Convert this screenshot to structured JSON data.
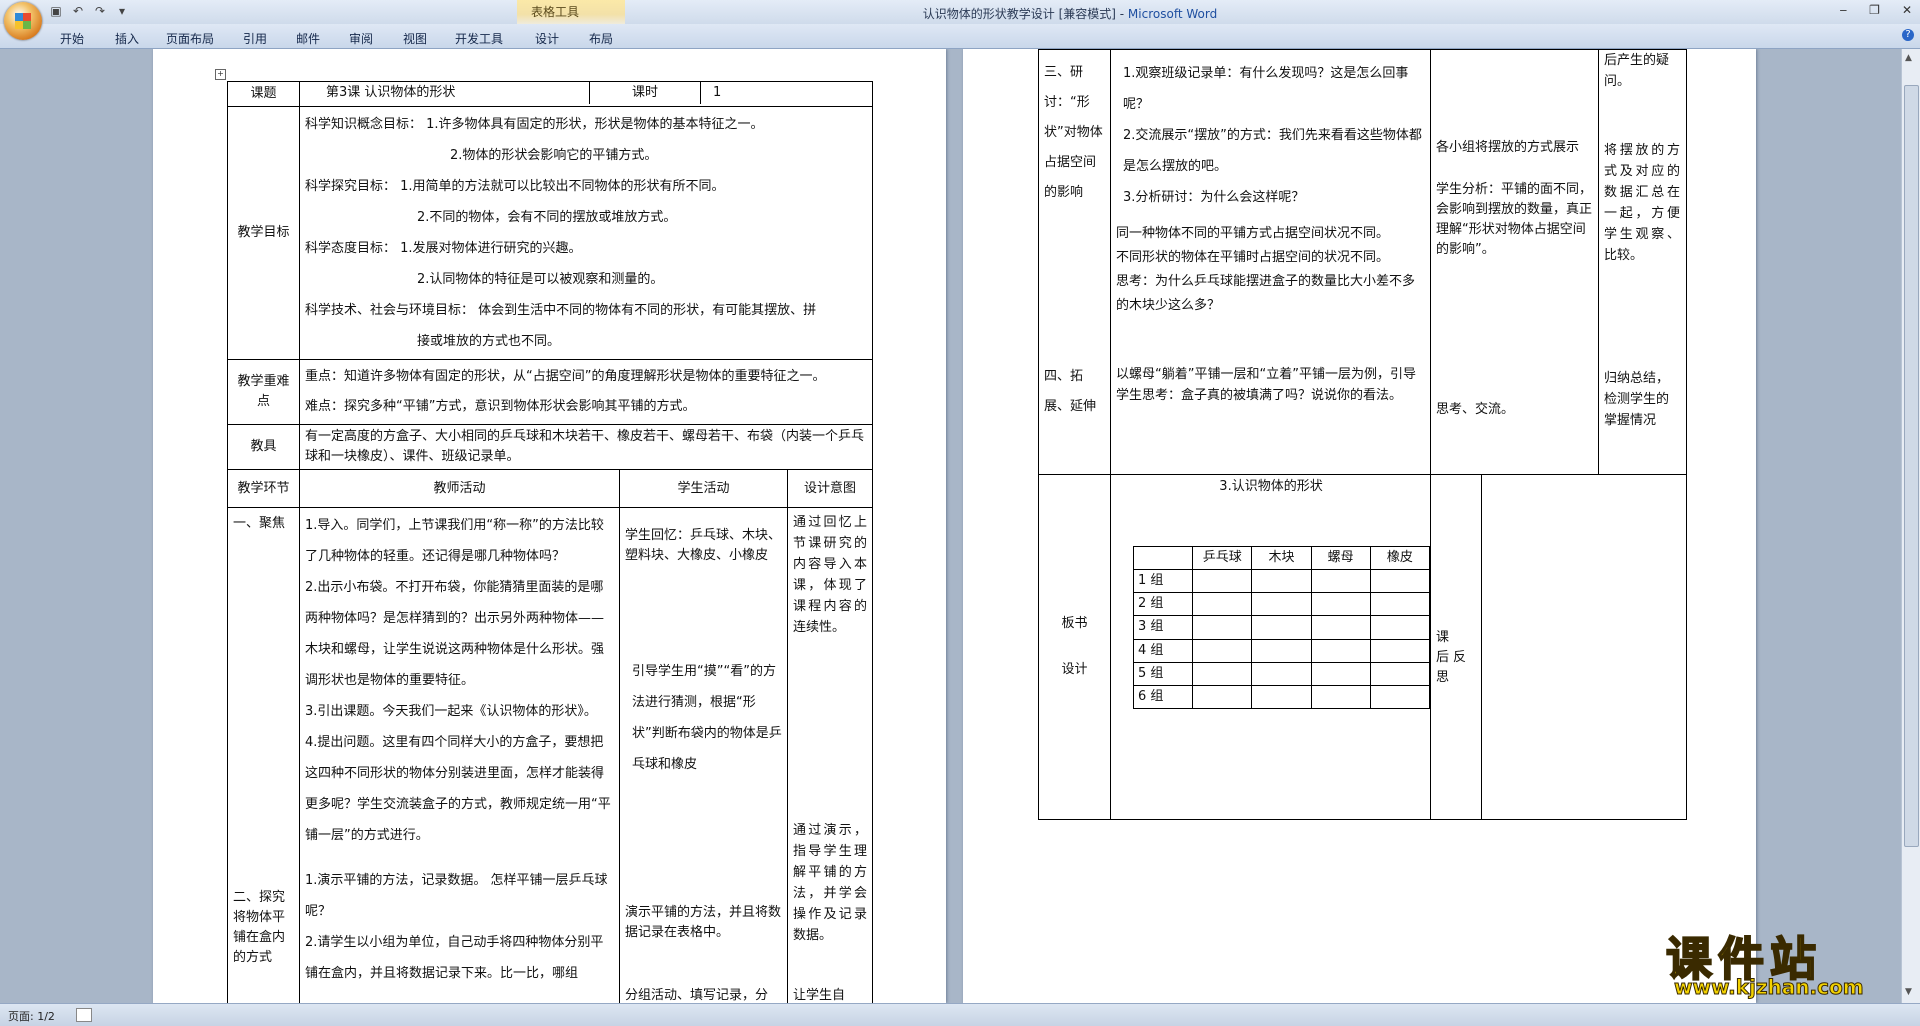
{
  "window": {
    "title": "认识物体的形状教学设计 [兼容模式] - ",
    "app_name": "Microsoft Word",
    "context_tab_group": "表格工具",
    "controls": [
      "‒",
      "❐",
      "✕"
    ]
  },
  "ribbon": {
    "tabs": [
      "开始",
      "插入",
      "页面布局",
      "引用",
      "邮件",
      "审阅",
      "视图",
      "开发工具",
      "设计",
      "布局"
    ]
  },
  "status": {
    "page": "页面: 1/2"
  },
  "watermark": {
    "text": "课件站",
    "url": "www.kjzhan.com"
  },
  "page1": {
    "header": {
      "label": "课题",
      "title": "第3课  认识物体的形状",
      "hours_label": "课时",
      "hours": "1"
    },
    "goals": {
      "label": "教学目标",
      "lines": [
        "科学知识概念目标：  1.许多物体具有固定的形状，形状是物体的基本特征之一。",
        "2.物体的形状会影响它的平铺方式。",
        "科学探究目标：  1.用简单的方法就可以比较出不同物体的形状有所不同。",
        "2.不同的物体，会有不同的摆放或堆放方式。",
        "科学态度目标：  1.发展对物体进行研究的兴趣。",
        "2.认同物体的特征是可以被观察和测量的。",
        "科学技术、社会与环境目标：   体会到生活中不同的物体有不同的形状，有可能其摆放、拼",
        "接或堆放的方式也不同。"
      ]
    },
    "keypoints": {
      "label": "教学重难点",
      "key": "重点：知道许多物体有固定的形状，从“占据空间”的角度理解形状是物体的重要特征之一。",
      "difficult": "难点：探究多种“平铺”方式，意识到物体形状会影响其平铺的方式。"
    },
    "materials": {
      "label": "教具",
      "text": "有一定高度的方盒子、大小相同的乒乓球和木块若干、橡皮若干、螺母若干、布袋（内装一个乒乓球和一块橡皮）、课件、班级记录单。"
    },
    "columns": [
      "教学环节",
      "教师活动",
      "学生活动",
      "设计意图"
    ],
    "stages": [
      "一、聚焦",
      "二、探究将物体平铺在盒内的方式"
    ],
    "teacher_text": [
      "1.导入。同学们，上节课我们用“称一称”的方法比较了几种物体的轻重。还记得是哪几种物体吗？",
      "2.出示小布袋。不打开布袋，你能猜猜里面装的是哪两种物体吗？是怎样猜到的？出示另外两种物体——木块和螺母，让学生说说这两种物体是什么形状。强调形状也是物体的重要特征。",
      "3.引出课题。今天我们一起来《认识物体的形状》。",
      "4.提出问题。这里有四个同样大小的方盒子，要想把这四种不同形状的物体分别装进里面，怎样才能装得更多呢？学生交流装盒子的方式，教师规定统一用“平铺一层”的方式进行。",
      "1.演示平铺的方法，记录数据。   怎样平铺一层乒乓球呢？",
      "2.请学生以小组为单位，自己动手将四种物体分别平铺在盒内，并且将数据记录下来。比一比，哪组"
    ],
    "student_text": [
      "学生回忆：乒乓球、木块、塑料块、大橡皮、小橡皮",
      "引导学生用“摸”“看”的方法进行猜测，根据“形状”判断布袋内的物体是乒乓球和橡皮",
      "演示平铺的方法，并且将数据记录在表格中。",
      "分组活动、填写记录，分"
    ],
    "intent_text": [
      "通过回忆上节课研究的内容导入本课，体现了课程内容的连续性。",
      "通过演示，指导学生理解平铺的方法，并学会操作及记录数据。",
      "让学生自"
    ]
  },
  "page2": {
    "stage3": "三、研讨：“形状”对物体占据空间的影响",
    "stage4": "四、拓展、延伸",
    "teacher_text": [
      "1.观察班级记录单：有什么发现吗？这是怎么回事呢？",
      "2.交流展示“摆放”的方式：我们先来看看这些物体都是怎么摆放的吧。",
      "3.分析研讨：为什么会这样呢？",
      "同一种物体不同的平铺方式占据空间状况不同。",
      "不同形状的物体在平铺时占据空间的状况不同。",
      "思考：为什么乒乓球能摆进盒子的数量比大小差不多的木块少这么多？",
      "以螺母“躺着”平铺一层和“立着”平铺一层为例，引导学生思考：盒子真的被填满了吗？说说你的看法。"
    ],
    "student_text": [
      "各小组将摆放的方式展示",
      "学生分析：平铺的面不同，会影响到摆放的数量，真正理解“形状对物体占据空间的影响”。",
      "思考、交流。"
    ],
    "intent_text": [
      "后产生的疑问。",
      "将摆放的方式及对应的数据汇总在一起，方便学生观察、比较。",
      "归纳总结，检测学生的掌握情况"
    ],
    "board": {
      "label1": "板书",
      "label2": "设计",
      "title": "3.认识物体的形状",
      "headers": [
        "",
        "乒乓球",
        "木块",
        "螺母",
        "橡皮"
      ],
      "rows": [
        "1 组",
        "2 组",
        "3 组",
        "4 组",
        "5 组",
        "6 组"
      ]
    },
    "reflection": "课 后反思"
  }
}
